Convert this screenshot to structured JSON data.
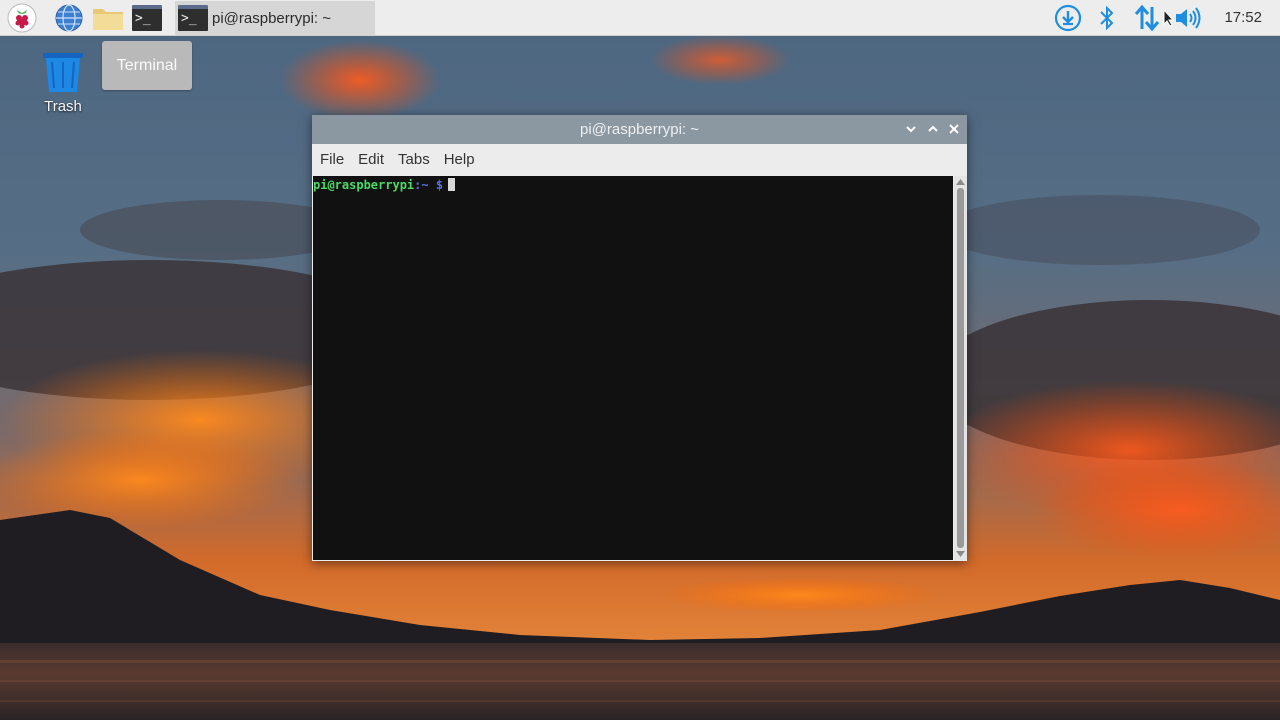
{
  "taskbar": {
    "launchers": [
      {
        "icon": "raspberry-menu-icon"
      },
      {
        "icon": "web-browser-globe-icon"
      },
      {
        "icon": "file-manager-folder-icon"
      },
      {
        "icon": "terminal-icon",
        "glyph": ">_"
      }
    ],
    "active_task": {
      "label": "pi@raspberrypi: ~",
      "icon": "terminal-icon",
      "glyph": ">_"
    },
    "tray": [
      "download-updates-icon",
      "bluetooth-icon",
      "network-arrows-icon",
      "volume-icon"
    ],
    "clock": "17:52"
  },
  "desktop": {
    "trash": {
      "label": "Trash",
      "icon": "trash-can-icon"
    },
    "tooltip": "Terminal"
  },
  "window": {
    "title": "pi@raspberrypi: ~",
    "controls": [
      "minimize-icon",
      "maximize-icon",
      "close-icon"
    ],
    "menu": [
      "File",
      "Edit",
      "Tabs",
      "Help"
    ],
    "prompt": {
      "user_host": "pi@raspberrypi",
      "separator": ":",
      "path": "~",
      "symbol": "$"
    }
  },
  "colors": {
    "taskbar_bg": "#ededed",
    "titlebar_bg": "#8b97a1",
    "terminal_bg": "#111111",
    "prompt_user": "#4cd964",
    "prompt_path": "#5a6fe0",
    "accent_blue": "#1f8ee0"
  }
}
